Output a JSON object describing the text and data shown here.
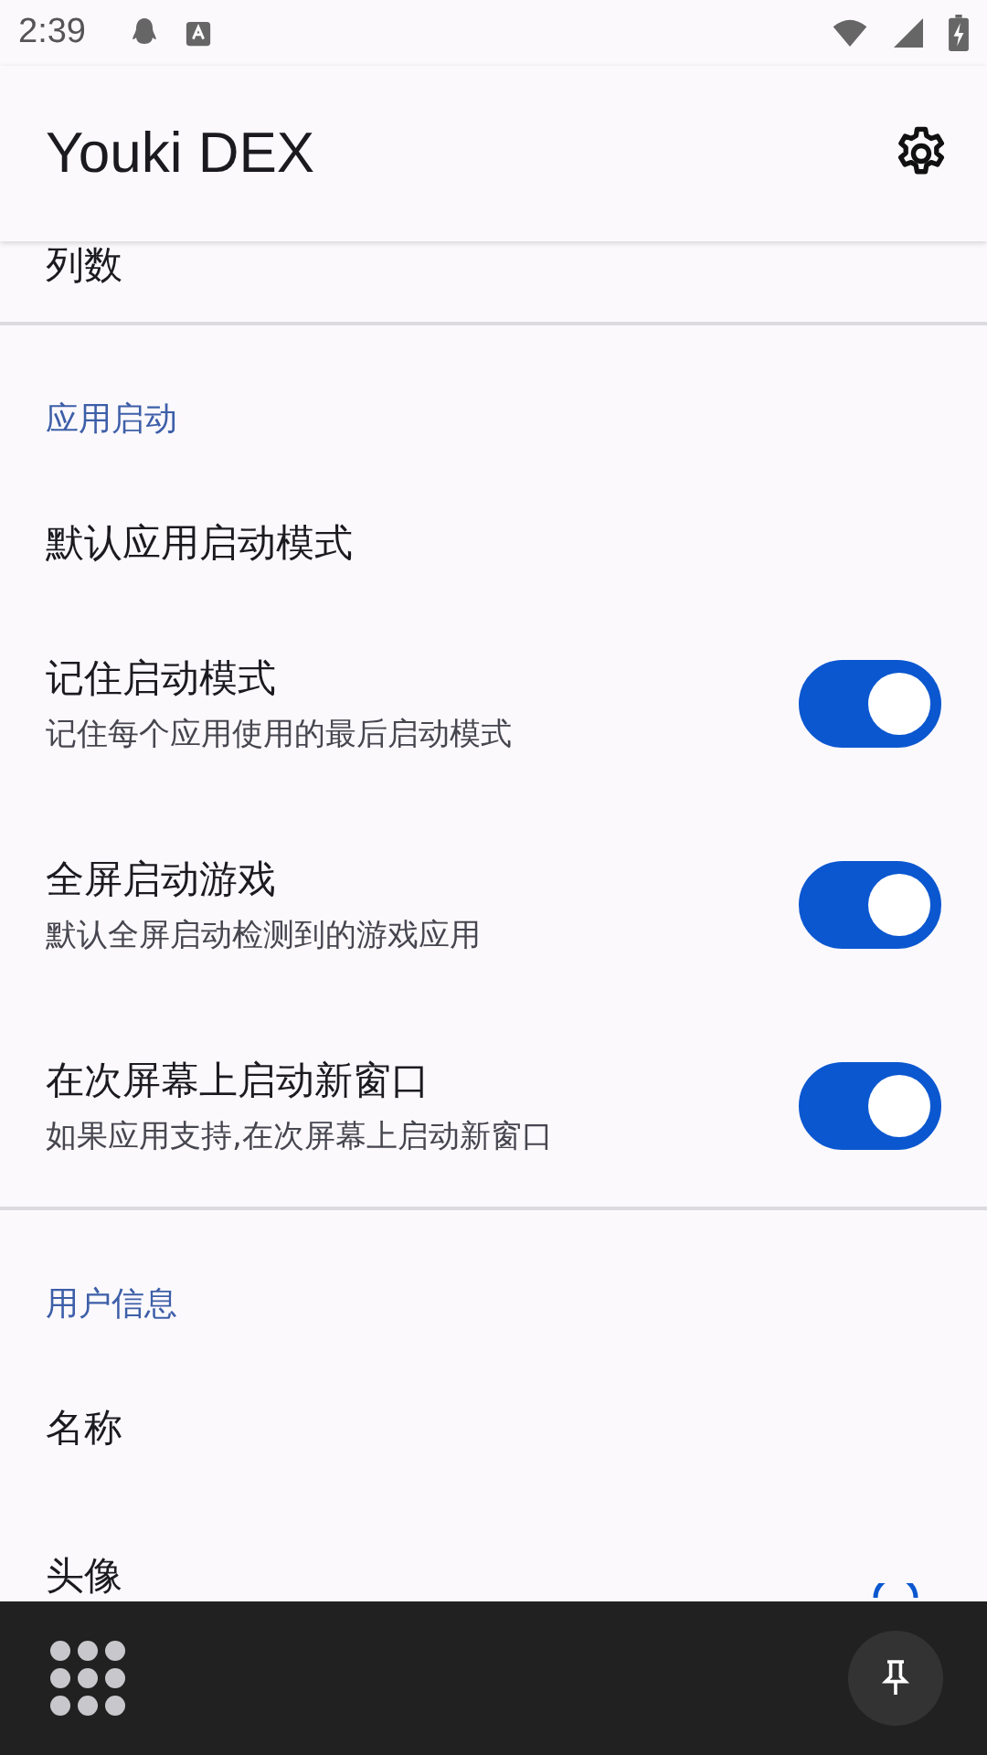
{
  "status_bar": {
    "time": "2:39"
  },
  "app_bar": {
    "title": "Youki DEX"
  },
  "items": [
    {
      "kind": "plain",
      "title": "列数"
    },
    {
      "kind": "divider"
    },
    {
      "kind": "header",
      "title": "应用启动"
    },
    {
      "kind": "plain",
      "title": "默认应用启动模式"
    },
    {
      "kind": "switch",
      "title": "记住启动模式",
      "subtitle": "记住每个应用使用的最后启动模式",
      "on": true
    },
    {
      "kind": "switch",
      "title": "全屏启动游戏",
      "subtitle": "默认全屏启动检测到的游戏应用",
      "on": true
    },
    {
      "kind": "switch",
      "title": "在次屏幕上启动新窗口",
      "subtitle": "如果应用支持,在次屏幕上启动新窗口",
      "on": true
    },
    {
      "kind": "divider"
    },
    {
      "kind": "header",
      "title": "用户信息"
    },
    {
      "kind": "plain",
      "title": "名称"
    },
    {
      "kind": "avatar",
      "title": "头像"
    }
  ]
}
